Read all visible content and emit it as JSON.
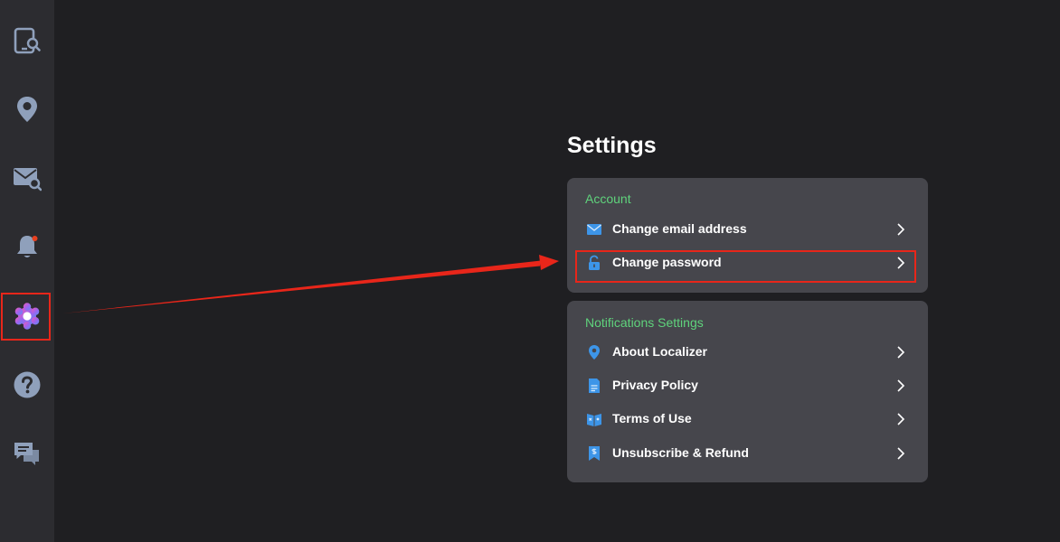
{
  "colors": {
    "background": "#1f1f22",
    "sidebar": "#2c2c30",
    "card": "#46464c",
    "section_label": "#5fd37c",
    "icon_blue": "#3d95e8",
    "sidebar_icon": "#8fa0bb",
    "annotation_red": "#e8261a"
  },
  "sidebar": {
    "items": [
      {
        "name": "phone-search",
        "icon": "phone-search-icon"
      },
      {
        "name": "location",
        "icon": "location-pin-icon"
      },
      {
        "name": "email-search",
        "icon": "email-search-icon"
      },
      {
        "name": "notifications",
        "icon": "bell-icon"
      },
      {
        "name": "settings",
        "icon": "gear-icon",
        "active": true
      },
      {
        "name": "help",
        "icon": "question-icon"
      },
      {
        "name": "chat",
        "icon": "chat-icon"
      }
    ]
  },
  "settings": {
    "title": "Settings",
    "account": {
      "label": "Account",
      "items": [
        {
          "label": "Change email address",
          "icon": "envelope-icon"
        },
        {
          "label": "Change password",
          "icon": "lock-icon"
        }
      ]
    },
    "notifications": {
      "label": "Notifications Settings",
      "items": [
        {
          "label": "About Localizer",
          "icon": "location-icon"
        },
        {
          "label": "Privacy Policy",
          "icon": "document-icon"
        },
        {
          "label": "Terms of Use",
          "icon": "book-icon"
        },
        {
          "label": "Unsubscribe & Refund",
          "icon": "refund-icon"
        }
      ]
    }
  }
}
